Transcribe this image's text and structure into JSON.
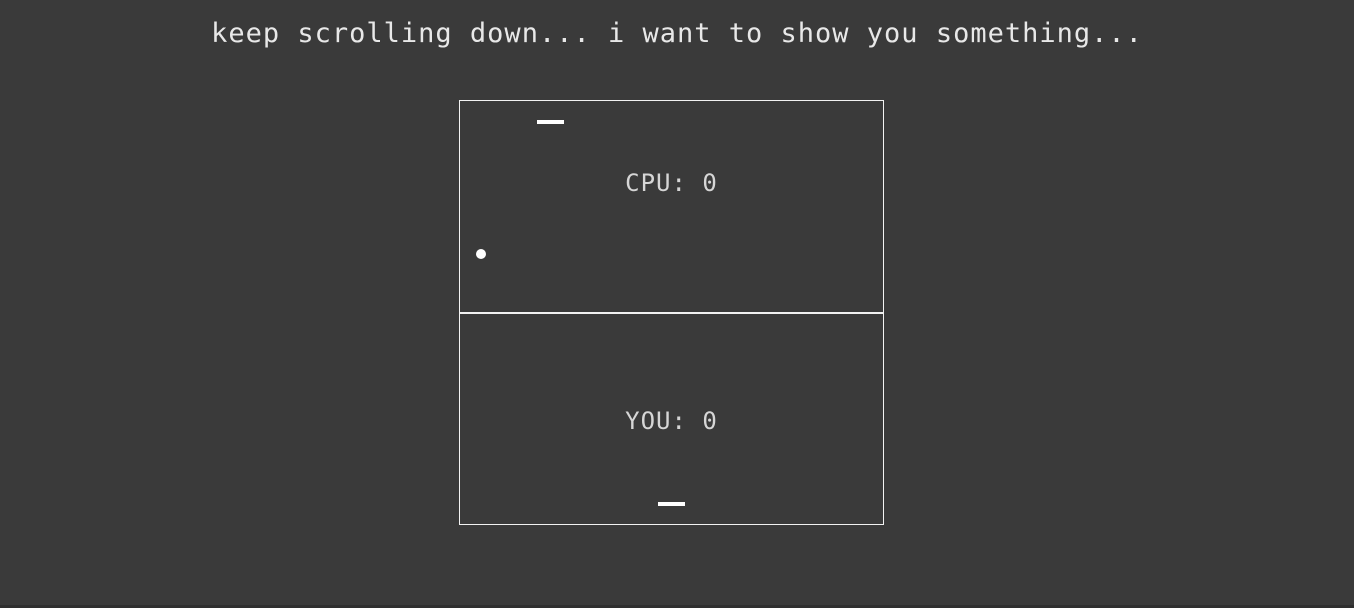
{
  "headline": "keep scrolling down... i want to show you something...",
  "game": {
    "cpu_score_label": "CPU: 0",
    "you_score_label": "YOU: 0"
  },
  "colors": {
    "background": "#3a3a3a",
    "board_border": "#f2f2f2",
    "paddle": "#ffffff",
    "ball": "#ffffff",
    "score_text": "#d6d6d6"
  }
}
